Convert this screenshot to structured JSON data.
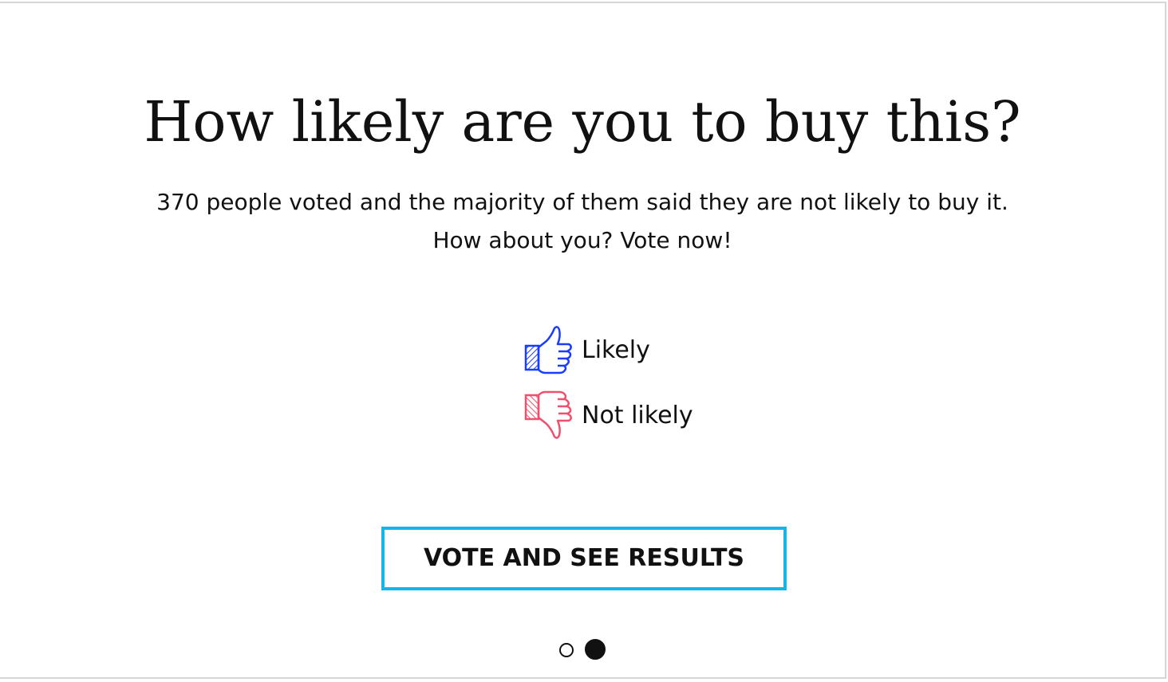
{
  "poll": {
    "title": "How likely are you to buy this?",
    "subtitle_line1": "370 people voted and the majority of them said they are not likely to buy it.",
    "subtitle_line2": "How about you? Vote now!",
    "options": [
      {
        "label": "Likely",
        "icon": "thumbs-up-icon",
        "color": "#1a3cff"
      },
      {
        "label": "Not likely",
        "icon": "thumbs-down-icon",
        "color": "#f0506e"
      }
    ],
    "submit_label": "VOTE AND SEE RESULTS",
    "accent_color": "#13b5ea"
  },
  "pagination": {
    "current_page": 2,
    "total_pages": 2
  }
}
